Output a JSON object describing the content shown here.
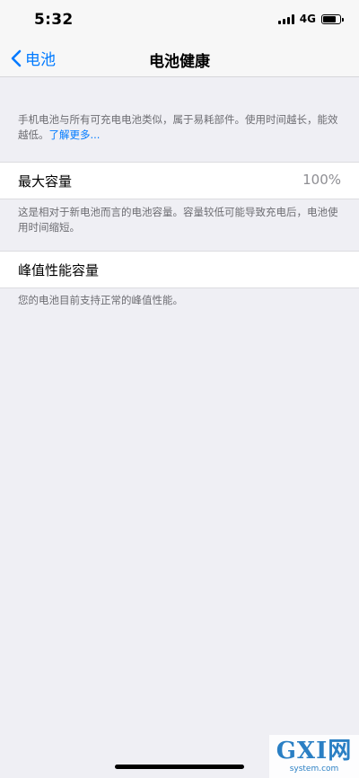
{
  "status_bar": {
    "time": "5:32",
    "network": "4G"
  },
  "nav": {
    "back_label": "电池",
    "title": "电池健康"
  },
  "intro": {
    "text": "手机电池与所有可充电电池类似，属于易耗部件。使用时间越长，能效越低。",
    "link": "了解更多..."
  },
  "max_capacity": {
    "label": "最大容量",
    "value": "100%",
    "note": "这是相对于新电池而言的电池容量。容量较低可能导致充电后，电池使用时间缩短。"
  },
  "peak_performance": {
    "label": "峰值性能容量",
    "note": "您的电池目前支持正常的峰值性能。"
  },
  "watermark": {
    "logo": "GXI网",
    "url": "system.com"
  },
  "colors": {
    "accent": "#007aff",
    "background": "#efeff4",
    "secondary_text": "#6d6d72"
  }
}
